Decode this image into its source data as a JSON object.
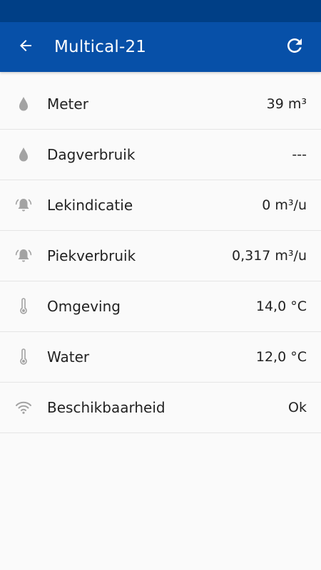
{
  "app_bar": {
    "title": "Multical-21",
    "back_icon": "arrow-left-icon",
    "refresh_icon": "refresh-icon",
    "color": "#0750a8",
    "status_bar_color": "#003f86"
  },
  "rows": [
    {
      "icon": "water-drop-icon",
      "label": "Meter",
      "value": "39 m³"
    },
    {
      "icon": "water-drop-icon",
      "label": "Dagverbruik",
      "value": "---"
    },
    {
      "icon": "alarm-bell-icon",
      "label": "Lekindicatie",
      "value": "0 m³/u"
    },
    {
      "icon": "alarm-bell-icon",
      "label": "Piekverbruik",
      "value": "0,317 m³/u"
    },
    {
      "icon": "thermometer-icon",
      "label": "Omgeving",
      "value": "14,0 °C"
    },
    {
      "icon": "thermometer-icon",
      "label": "Water",
      "value": "12,0 °C"
    },
    {
      "icon": "wifi-icon",
      "label": "Beschikbaarheid",
      "value": "Ok"
    }
  ]
}
